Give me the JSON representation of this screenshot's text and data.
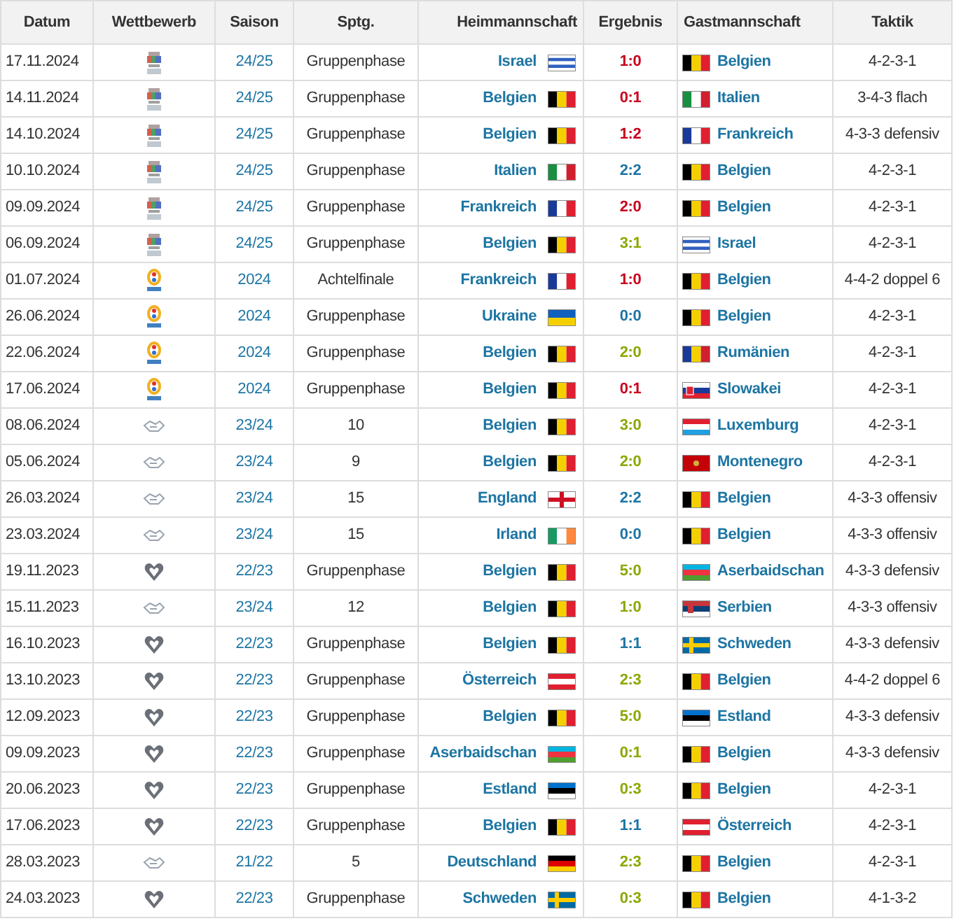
{
  "columns": [
    "Datum",
    "Wettbewerb",
    "Saison",
    "Sptg.",
    "Heimmannschaft",
    "Ergebnis",
    "Gastmannschaft",
    "Taktik"
  ],
  "rows": [
    {
      "date": "17.11.2024",
      "kind": "nations_league",
      "season": "24/25",
      "matchday": "Gruppenphase",
      "home": {
        "name": "Israel",
        "kind": "il"
      },
      "result": "1:0",
      "color": "#c8001e",
      "away": {
        "name": "Belgien",
        "kind": "be"
      },
      "tactic": "4-2-3-1"
    },
    {
      "date": "14.11.2024",
      "kind": "nations_league",
      "season": "24/25",
      "matchday": "Gruppenphase",
      "home": {
        "name": "Belgien",
        "kind": "be"
      },
      "result": "0:1",
      "color": "#c8001e",
      "away": {
        "name": "Italien",
        "kind": "it"
      },
      "tactic": "3-4-3 flach"
    },
    {
      "date": "14.10.2024",
      "kind": "nations_league",
      "season": "24/25",
      "matchday": "Gruppenphase",
      "home": {
        "name": "Belgien",
        "kind": "be"
      },
      "result": "1:2",
      "color": "#c8001e",
      "away": {
        "name": "Frankreich",
        "kind": "fr"
      },
      "tactic": "4-3-3 defensiv"
    },
    {
      "date": "10.10.2024",
      "kind": "nations_league",
      "season": "24/25",
      "matchday": "Gruppenphase",
      "home": {
        "name": "Italien",
        "kind": "it"
      },
      "result": "2:2",
      "color": "#1d75a3",
      "away": {
        "name": "Belgien",
        "kind": "be"
      },
      "tactic": "4-2-3-1"
    },
    {
      "date": "09.09.2024",
      "kind": "nations_league",
      "season": "24/25",
      "matchday": "Gruppenphase",
      "home": {
        "name": "Frankreich",
        "kind": "fr"
      },
      "result": "2:0",
      "color": "#c8001e",
      "away": {
        "name": "Belgien",
        "kind": "be"
      },
      "tactic": "4-2-3-1"
    },
    {
      "date": "06.09.2024",
      "kind": "nations_league",
      "season": "24/25",
      "matchday": "Gruppenphase",
      "home": {
        "name": "Belgien",
        "kind": "be"
      },
      "result": "3:1",
      "color": "#8aa800",
      "away": {
        "name": "Israel",
        "kind": "il"
      },
      "tactic": "4-2-3-1"
    },
    {
      "date": "01.07.2024",
      "kind": "euro",
      "season": "2024",
      "matchday": "Achtelfinale",
      "home": {
        "name": "Frankreich",
        "kind": "fr"
      },
      "result": "1:0",
      "color": "#c8001e",
      "away": {
        "name": "Belgien",
        "kind": "be"
      },
      "tactic": "4-4-2 doppel 6"
    },
    {
      "date": "26.06.2024",
      "kind": "euro",
      "season": "2024",
      "matchday": "Gruppenphase",
      "home": {
        "name": "Ukraine",
        "kind": "ua"
      },
      "result": "0:0",
      "color": "#1d75a3",
      "away": {
        "name": "Belgien",
        "kind": "be"
      },
      "tactic": "4-2-3-1"
    },
    {
      "date": "22.06.2024",
      "kind": "euro",
      "season": "2024",
      "matchday": "Gruppenphase",
      "home": {
        "name": "Belgien",
        "kind": "be"
      },
      "result": "2:0",
      "color": "#8aa800",
      "away": {
        "name": "Rumänien",
        "kind": "ro"
      },
      "tactic": "4-2-3-1"
    },
    {
      "date": "17.06.2024",
      "kind": "euro",
      "season": "2024",
      "matchday": "Gruppenphase",
      "home": {
        "name": "Belgien",
        "kind": "be"
      },
      "result": "0:1",
      "color": "#c8001e",
      "away": {
        "name": "Slowakei",
        "kind": "sk"
      },
      "tactic": "4-2-3-1"
    },
    {
      "date": "08.06.2024",
      "kind": "friendly",
      "season": "23/24",
      "matchday": "10",
      "home": {
        "name": "Belgien",
        "kind": "be"
      },
      "result": "3:0",
      "color": "#8aa800",
      "away": {
        "name": "Luxemburg",
        "kind": "lu"
      },
      "tactic": "4-2-3-1"
    },
    {
      "date": "05.06.2024",
      "kind": "friendly",
      "season": "23/24",
      "matchday": "9",
      "home": {
        "name": "Belgien",
        "kind": "be"
      },
      "result": "2:0",
      "color": "#8aa800",
      "away": {
        "name": "Montenegro",
        "kind": "me"
      },
      "tactic": "4-2-3-1"
    },
    {
      "date": "26.03.2024",
      "kind": "friendly",
      "season": "23/24",
      "matchday": "15",
      "home": {
        "name": "England",
        "kind": "en"
      },
      "result": "2:2",
      "color": "#1d75a3",
      "away": {
        "name": "Belgien",
        "kind": "be"
      },
      "tactic": "4-3-3 offensiv"
    },
    {
      "date": "23.03.2024",
      "kind": "friendly",
      "season": "23/24",
      "matchday": "15",
      "home": {
        "name": "Irland",
        "kind": "ie"
      },
      "result": "0:0",
      "color": "#1d75a3",
      "away": {
        "name": "Belgien",
        "kind": "be"
      },
      "tactic": "4-3-3 offensiv"
    },
    {
      "date": "19.11.2023",
      "kind": "qualifier",
      "season": "22/23",
      "matchday": "Gruppenphase",
      "home": {
        "name": "Belgien",
        "kind": "be"
      },
      "result": "5:0",
      "color": "#8aa800",
      "away": {
        "name": "Aserbaidschan",
        "kind": "az"
      },
      "tactic": "4-3-3 defensiv"
    },
    {
      "date": "15.11.2023",
      "kind": "friendly",
      "season": "23/24",
      "matchday": "12",
      "home": {
        "name": "Belgien",
        "kind": "be"
      },
      "result": "1:0",
      "color": "#8aa800",
      "away": {
        "name": "Serbien",
        "kind": "rs"
      },
      "tactic": "4-3-3 offensiv"
    },
    {
      "date": "16.10.2023",
      "kind": "qualifier",
      "season": "22/23",
      "matchday": "Gruppenphase",
      "home": {
        "name": "Belgien",
        "kind": "be"
      },
      "result": "1:1",
      "color": "#1d75a3",
      "away": {
        "name": "Schweden",
        "kind": "se"
      },
      "tactic": "4-3-3 defensiv"
    },
    {
      "date": "13.10.2023",
      "kind": "qualifier",
      "season": "22/23",
      "matchday": "Gruppenphase",
      "home": {
        "name": "Österreich",
        "kind": "at"
      },
      "result": "2:3",
      "color": "#8aa800",
      "away": {
        "name": "Belgien",
        "kind": "be"
      },
      "tactic": "4-4-2 doppel 6"
    },
    {
      "date": "12.09.2023",
      "kind": "qualifier",
      "season": "22/23",
      "matchday": "Gruppenphase",
      "home": {
        "name": "Belgien",
        "kind": "be"
      },
      "result": "5:0",
      "color": "#8aa800",
      "away": {
        "name": "Estland",
        "kind": "ee"
      },
      "tactic": "4-3-3 defensiv"
    },
    {
      "date": "09.09.2023",
      "kind": "qualifier",
      "season": "22/23",
      "matchday": "Gruppenphase",
      "home": {
        "name": "Aserbaidschan",
        "kind": "az"
      },
      "result": "0:1",
      "color": "#8aa800",
      "away": {
        "name": "Belgien",
        "kind": "be"
      },
      "tactic": "4-3-3 defensiv"
    },
    {
      "date": "20.06.2023",
      "kind": "qualifier",
      "season": "22/23",
      "matchday": "Gruppenphase",
      "home": {
        "name": "Estland",
        "kind": "ee"
      },
      "result": "0:3",
      "color": "#8aa800",
      "away": {
        "name": "Belgien",
        "kind": "be"
      },
      "tactic": "4-2-3-1"
    },
    {
      "date": "17.06.2023",
      "kind": "qualifier",
      "season": "22/23",
      "matchday": "Gruppenphase",
      "home": {
        "name": "Belgien",
        "kind": "be"
      },
      "result": "1:1",
      "color": "#1d75a3",
      "away": {
        "name": "Österreich",
        "kind": "at"
      },
      "tactic": "4-2-3-1"
    },
    {
      "date": "28.03.2023",
      "kind": "friendly",
      "season": "21/22",
      "matchday": "5",
      "home": {
        "name": "Deutschland",
        "kind": "de"
      },
      "result": "2:3",
      "color": "#8aa800",
      "away": {
        "name": "Belgien",
        "kind": "be"
      },
      "tactic": "4-2-3-1"
    },
    {
      "date": "24.03.2023",
      "kind": "qualifier",
      "season": "22/23",
      "matchday": "Gruppenphase",
      "home": {
        "name": "Schweden",
        "kind": "se"
      },
      "result": "0:3",
      "color": "#8aa800",
      "away": {
        "name": "Belgien",
        "kind": "be"
      },
      "tactic": "4-1-3-2"
    }
  ]
}
